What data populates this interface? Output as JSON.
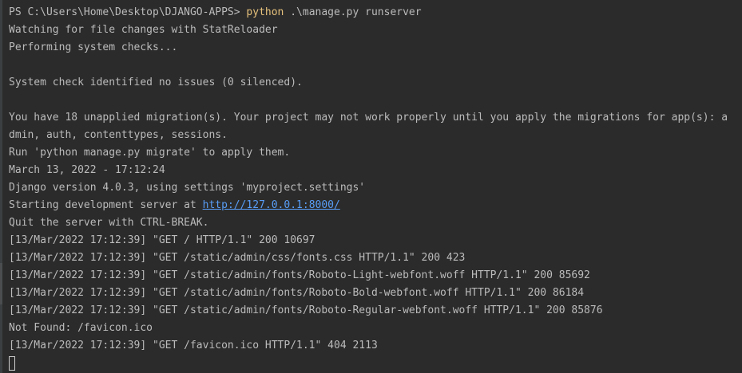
{
  "terminal": {
    "prompt": "PS C:\\Users\\Home\\Desktop\\DJANGO-APPS> ",
    "command_keyword": "python",
    "command_args": " .\\manage.py runserver",
    "lines": {
      "l1": "Watching for file changes with StatReloader",
      "l2": "Performing system checks...",
      "l3": "",
      "l4": "System check identified no issues (0 silenced).",
      "l5": "",
      "l6": "You have 18 unapplied migration(s). Your project may not work properly until you apply the migrations for app(s): a",
      "l7": "dmin, auth, contenttypes, sessions.",
      "l8": "Run 'python manage.py migrate' to apply them.",
      "l9": "March 13, 2022 - 17:12:24",
      "l10": "Django version 4.0.3, using settings 'myproject.settings'",
      "l11_prefix": "Starting development server at ",
      "l11_link": "http://127.0.0.1:8000/",
      "l12": "Quit the server with CTRL-BREAK.",
      "l13": "[13/Mar/2022 17:12:39] \"GET / HTTP/1.1\" 200 10697",
      "l14": "[13/Mar/2022 17:12:39] \"GET /static/admin/css/fonts.css HTTP/1.1\" 200 423",
      "l15": "[13/Mar/2022 17:12:39] \"GET /static/admin/fonts/Roboto-Light-webfont.woff HTTP/1.1\" 200 85692",
      "l16": "[13/Mar/2022 17:12:39] \"GET /static/admin/fonts/Roboto-Bold-webfont.woff HTTP/1.1\" 200 86184",
      "l17": "[13/Mar/2022 17:12:39] \"GET /static/admin/fonts/Roboto-Regular-webfont.woff HTTP/1.1\" 200 85876",
      "l18": "Not Found: /favicon.ico",
      "l19": "[13/Mar/2022 17:12:39] \"GET /favicon.ico HTTP/1.1\" 404 2113"
    }
  },
  "colors": {
    "background": "#2b2b2b",
    "text": "#bbbbbb",
    "command_keyword": "#e5c07b",
    "link": "#589df6"
  }
}
